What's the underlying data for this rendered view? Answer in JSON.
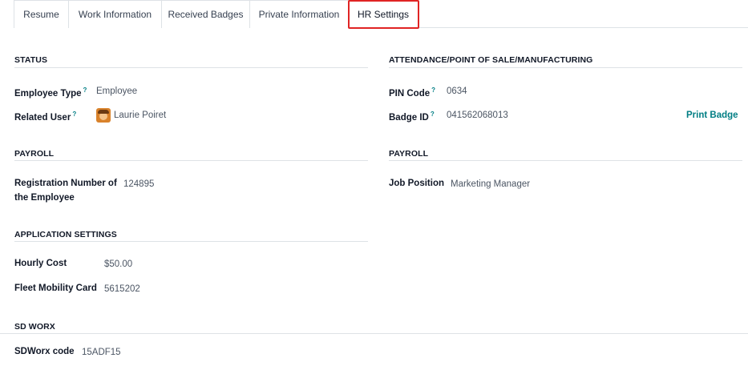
{
  "tabs": [
    {
      "label": "Resume"
    },
    {
      "label": "Work Information"
    },
    {
      "label": "Received Badges"
    },
    {
      "label": "Private Information"
    },
    {
      "label": "HR Settings"
    }
  ],
  "active_tab": "HR Settings",
  "status": {
    "title": "STATUS",
    "employee_type_label": "Employee Type",
    "employee_type_value": "Employee",
    "related_user_label": "Related User",
    "related_user_value": "Laurie Poiret",
    "help_mark": "?"
  },
  "attendance": {
    "title": "ATTENDANCE/POINT OF SALE/MANUFACTURING",
    "pin_label": "PIN Code",
    "pin_value": "0634",
    "badge_label": "Badge ID",
    "badge_value": "041562068013",
    "print_badge": "Print Badge"
  },
  "payroll_left": {
    "title": "PAYROLL",
    "reg_label_line1": "Registration Number of",
    "reg_label_line2": "the Employee",
    "reg_value": "124895"
  },
  "payroll_right": {
    "title": "PAYROLL",
    "job_label": "Job Position",
    "job_value": "Marketing Manager"
  },
  "application": {
    "title": "APPLICATION SETTINGS",
    "hourly_label": "Hourly Cost",
    "hourly_value": "$50.00",
    "fleet_label": "Fleet Mobility Card",
    "fleet_value": "5615202"
  },
  "sdworx": {
    "title": "SD WORX",
    "code_label": "SDWorx code",
    "code_value": "15ADF15"
  },
  "colors": {
    "accent": "#017e84",
    "highlight": "#e02424"
  }
}
